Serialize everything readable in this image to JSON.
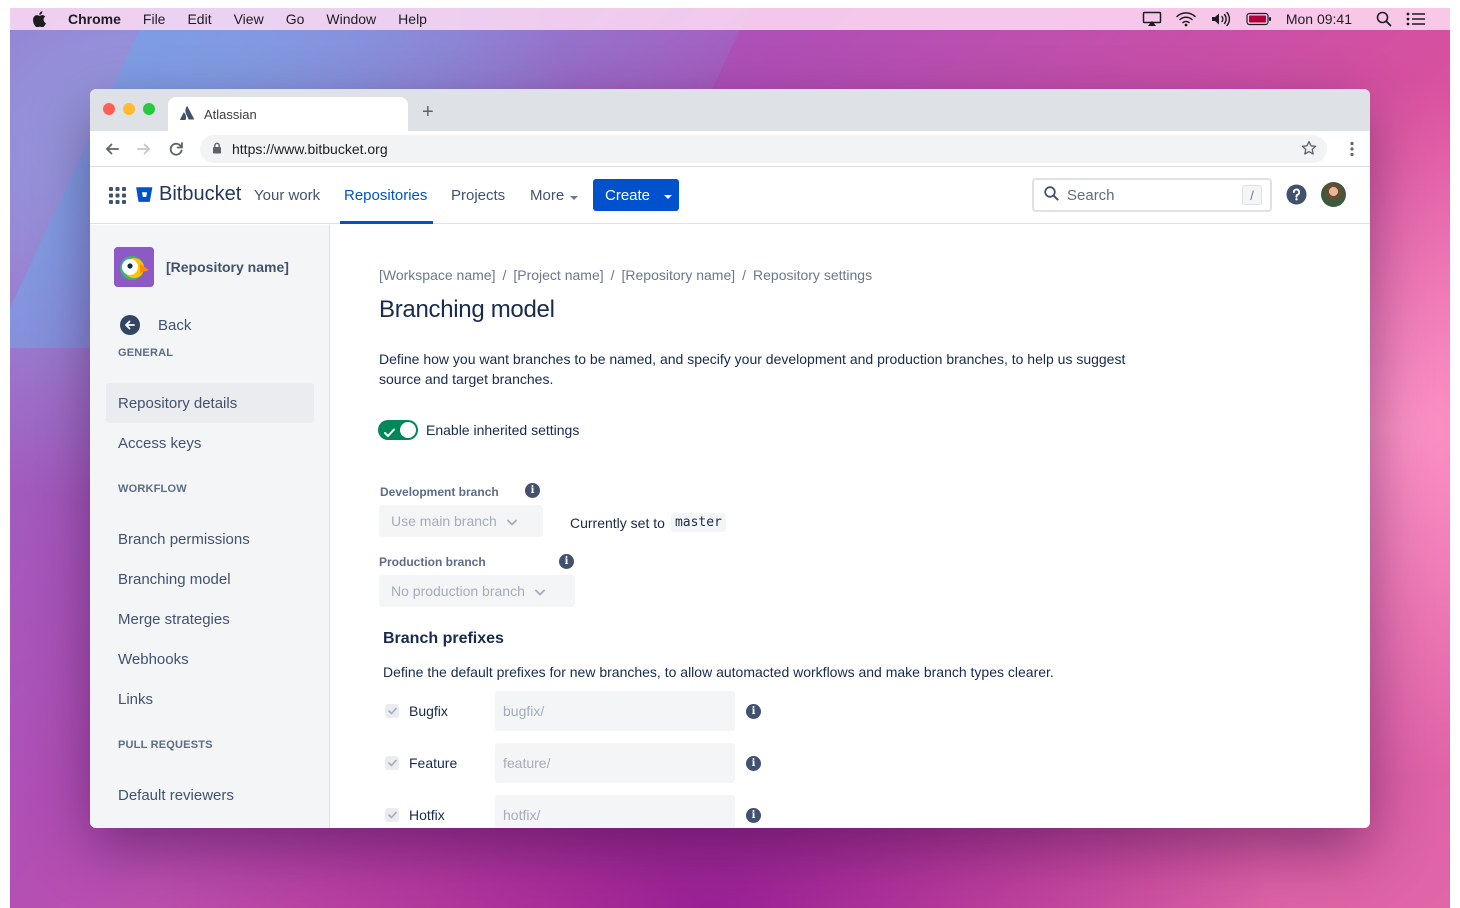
{
  "menubar": {
    "app_name": "Chrome",
    "items": [
      "File",
      "Edit",
      "View",
      "Go",
      "Window",
      "Help"
    ],
    "clock": "Mon 09:41",
    "status_icons": [
      "airplay-icon",
      "wifi-icon",
      "volume-icon",
      "battery-icon",
      "spotlight-icon",
      "control-center-icon"
    ]
  },
  "browser": {
    "tab_title": "Atlassian",
    "url": "https://www.bitbucket.org"
  },
  "appnav": {
    "product": "Bitbucket",
    "links": [
      "Your work",
      "Repositories",
      "Projects",
      "More"
    ],
    "active_link": "Repositories",
    "create_label": "Create",
    "search_placeholder": "Search",
    "search_shortcut": "/",
    "brand_color": "#0052cc"
  },
  "sidebar": {
    "repo_name": "[Repository name]",
    "back_label": "Back",
    "sections": [
      {
        "label": "GENERAL",
        "items": [
          "Repository details",
          "Access keys"
        ]
      },
      {
        "label": "WORKFLOW",
        "items": [
          "Branch permissions",
          "Branching model",
          "Merge strategies",
          "Webhooks",
          "Links"
        ]
      },
      {
        "label": "PULL REQUESTS",
        "items": [
          "Default reviewers"
        ]
      }
    ],
    "selected_item": "Repository details"
  },
  "main": {
    "breadcrumb": [
      "[Workspace name]",
      "[Project name]",
      "[Repository name]",
      "Repository settings"
    ],
    "title": "Branching model",
    "description": "Define how you want branches to be named, and specify your development and production branches, to help us suggest source and target branches.",
    "toggle_label": "Enable inherited settings",
    "toggle_on": true,
    "development_branch": {
      "label": "Development branch",
      "value": "Use main branch",
      "currently_set_label": "Currently set to",
      "currently_set_value": "master"
    },
    "production_branch": {
      "label": "Production branch",
      "value": "No production branch"
    },
    "prefixes_title": "Branch prefixes",
    "prefixes_description": "Define the default prefixes for new branches, to allow automacted workflows and make branch types clearer.",
    "prefixes": [
      {
        "label": "Bugfix",
        "placeholder": "bugfix/"
      },
      {
        "label": "Feature",
        "placeholder": "feature/"
      },
      {
        "label": "Hotfix",
        "placeholder": "hotfix/"
      }
    ]
  }
}
